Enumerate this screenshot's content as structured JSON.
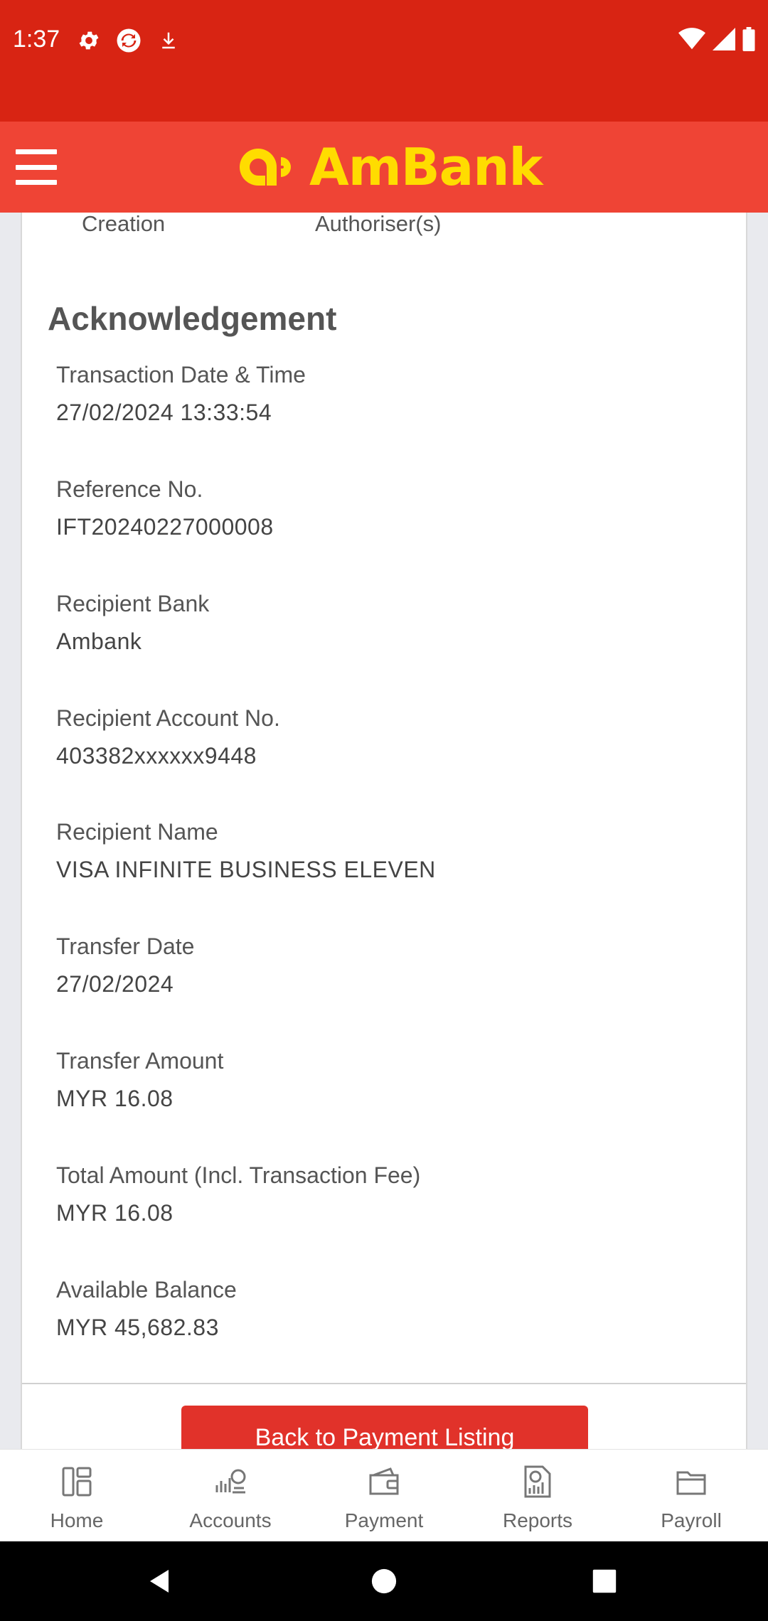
{
  "status_bar": {
    "time": "1:37",
    "left_icons": [
      "settings-icon",
      "sync-icon",
      "download-icon"
    ],
    "right_icons": [
      "wifi-icon",
      "signal-icon",
      "battery-icon"
    ]
  },
  "header": {
    "brand": "AmBank",
    "menu_icon": "hamburger-menu-icon",
    "colors": {
      "header_bg": "#ef4435",
      "status_bg": "#d82413",
      "logo": "#ffdc00"
    }
  },
  "previous_row": {
    "col1": "Creation",
    "col2": "Authoriser(s)"
  },
  "acknowledgement": {
    "title": "Acknowledgement",
    "fields": [
      {
        "label": "Transaction Date & Time",
        "value": "27/02/2024 13:33:54"
      },
      {
        "label": "Reference No.",
        "value": "IFT20240227000008"
      },
      {
        "label": "Recipient Bank",
        "value": "Ambank"
      },
      {
        "label": "Recipient Account No.",
        "value": "403382xxxxxx9448"
      },
      {
        "label": "Recipient Name",
        "value": "VISA INFINITE BUSINESS ELEVEN"
      },
      {
        "label": "Transfer Date",
        "value": "27/02/2024"
      },
      {
        "label": "Transfer Amount",
        "value": "MYR 16.08"
      },
      {
        "label": "Total Amount (Incl. Transaction Fee)",
        "value": "MYR 16.08"
      },
      {
        "label": "Available Balance",
        "value": "MYR 45,682.83"
      }
    ]
  },
  "actions": {
    "back_label": "Back to Payment Listing"
  },
  "bottom_nav": {
    "items": [
      {
        "label": "Home",
        "icon": "home-icon"
      },
      {
        "label": "Accounts",
        "icon": "accounts-icon"
      },
      {
        "label": "Payment",
        "icon": "wallet-icon"
      },
      {
        "label": "Reports",
        "icon": "reports-icon"
      },
      {
        "label": "Payroll",
        "icon": "payroll-icon"
      }
    ]
  },
  "system_nav": [
    "back-icon",
    "home-circle-icon",
    "recents-icon"
  ]
}
